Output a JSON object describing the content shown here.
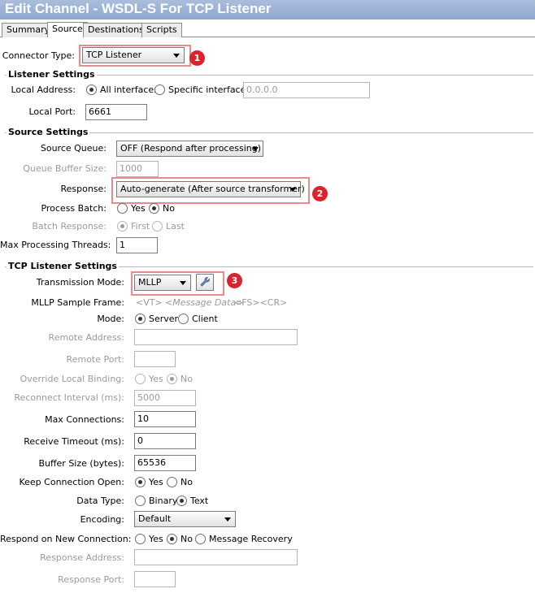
{
  "window": {
    "title": "Edit Channel - WSDL-S For TCP Listener"
  },
  "tabs": [
    {
      "label": "Summary"
    },
    {
      "label": "Source"
    },
    {
      "label": "Destinations"
    },
    {
      "label": "Scripts"
    }
  ],
  "connector": {
    "label": "Connector Type:",
    "value": "TCP Listener",
    "badge": "1"
  },
  "listener": {
    "section": "Listener Settings",
    "local_address_label": "Local Address:",
    "all_interfaces": "All interfaces",
    "specific_interface": "Specific interface:",
    "ip_value": "0.0.0.0",
    "local_port_label": "Local Port:",
    "local_port": "6661"
  },
  "source": {
    "section": "Source Settings",
    "queue_label": "Source Queue:",
    "queue_value": "OFF (Respond after processing)",
    "buffer_label": "Queue Buffer Size:",
    "buffer_value": "1000",
    "response_label": "Response:",
    "response_value": "Auto-generate (After source transformer)",
    "badge": "2",
    "process_batch_label": "Process Batch:",
    "yes": "Yes",
    "no": "No",
    "batch_response_label": "Batch Response:",
    "first": "First",
    "last": "Last",
    "threads_label": "Max Processing Threads:",
    "threads_value": "1"
  },
  "tcp": {
    "section": "TCP Listener Settings",
    "mode_label": "Transmission Mode:",
    "mode_value": "MLLP",
    "badge": "3",
    "frame_label": "MLLP Sample Frame:",
    "frame_vt": "<VT>",
    "frame_msg": "<Message Data>",
    "frame_end": "<FS><CR>",
    "mode2_label": "Mode:",
    "server": "Server",
    "client": "Client",
    "remote_address_label": "Remote Address:",
    "remote_address_value": "",
    "remote_port_label": "Remote Port:",
    "remote_port_value": "",
    "override_label": "Override Local Binding:",
    "yes": "Yes",
    "no": "No",
    "reconnect_label": "Reconnect Interval (ms):",
    "reconnect_value": "5000",
    "max_conn_label": "Max Connections:",
    "max_conn_value": "10",
    "timeout_label": "Receive Timeout (ms):",
    "timeout_value": "0",
    "bufsize_label": "Buffer Size (bytes):",
    "bufsize_value": "65536",
    "keep_open_label": "Keep Connection Open:",
    "data_type_label": "Data Type:",
    "binary": "Binary",
    "text": "Text",
    "encoding_label": "Encoding:",
    "encoding_value": "Default",
    "respond_new_label": "Respond on New Connection:",
    "message_recovery": "Message Recovery",
    "response_address_label": "Response Address:",
    "response_address_value": "",
    "response_port_label": "Response Port:",
    "response_port_value": ""
  },
  "colors": {
    "title_bg": "#9bb2d6",
    "highlight": "#e98b8b",
    "badge": "#d8242a"
  }
}
